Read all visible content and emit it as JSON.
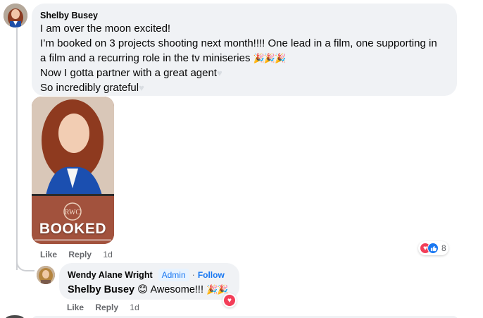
{
  "comment": {
    "author": "Shelby Busey",
    "lines": [
      "I am over the moon excited!",
      "I’m booked on 3 projects shooting next month!!!! One lead in a film, one supporting in",
      "a film and a recurring role in the tv miniseries",
      "Now I gotta partner with a great agent",
      "So incredibly grateful"
    ],
    "media_label": "BOOKED",
    "media_logo": "RWC",
    "actions": {
      "like": "Like",
      "reply": "Reply",
      "time": "1d"
    },
    "reaction_count": "8",
    "reaction_icons": [
      "love-icon",
      "like-icon"
    ]
  },
  "reply": {
    "author": "Wendy Alane Wright",
    "badge": "Admin",
    "follow": "Follow",
    "mention": "Shelby Busey",
    "text": "Awesome!!!",
    "actions": {
      "like": "Like",
      "reply": "Reply",
      "time": "1d"
    },
    "reaction_icon": "love-icon"
  },
  "colors": {
    "bubble": "#f0f2f5",
    "link": "#1877f2",
    "love": "#f33e58",
    "meta": "#65676b"
  }
}
